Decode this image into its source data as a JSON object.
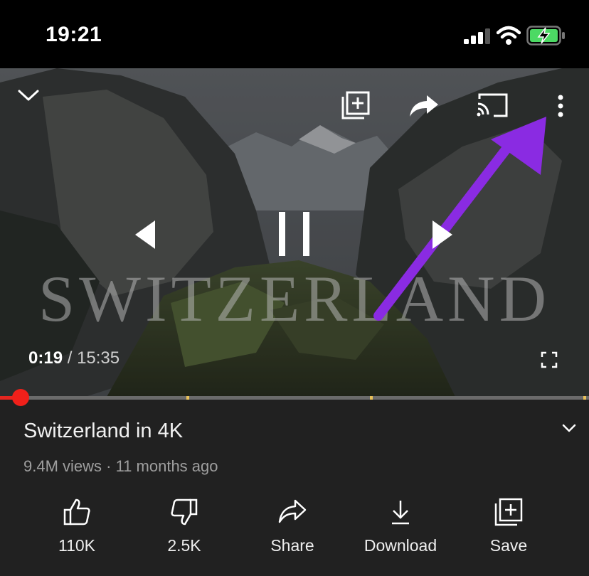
{
  "status_bar": {
    "time": "19:21",
    "battery": "charging",
    "icons": [
      "signal-icon",
      "wifi-icon",
      "battery-charging-icon"
    ]
  },
  "player": {
    "overlay_text": "SWITZERLAND",
    "current_time": "0:19",
    "separator": "/",
    "duration": "15:35",
    "progress_fraction": 0.02,
    "icons": [
      "collapse-chevron-icon",
      "add-to-playlist-icon",
      "share-icon",
      "cast-icon",
      "more-options-icon",
      "previous-icon",
      "pause-icon",
      "next-icon",
      "fullscreen-icon"
    ]
  },
  "video": {
    "title": "Switzerland in 4K",
    "meta": "9.4M views · 11 months ago"
  },
  "actions": [
    {
      "label": "110K",
      "icon": "like-icon"
    },
    {
      "label": "2.5K",
      "icon": "dislike-icon"
    },
    {
      "label": "Share",
      "icon": "share-icon"
    },
    {
      "label": "Download",
      "icon": "download-icon"
    },
    {
      "label": "Save",
      "icon": "save-icon"
    }
  ],
  "colors": {
    "progress": "#e52620",
    "annotation_arrow": "#8a2be2",
    "panel": "#212121"
  }
}
